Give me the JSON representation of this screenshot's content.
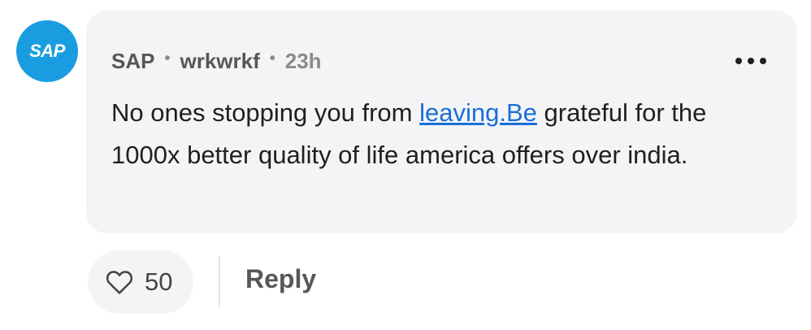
{
  "avatar": {
    "text": "SAP",
    "color": "#1a9de0"
  },
  "comment": {
    "company": "SAP",
    "username": "wrkwrkf",
    "separator": "•",
    "time": "23h",
    "more_icon": "more-horizontal-icon",
    "text_before_link": "No ones stopping you from ",
    "link_text": "leaving.Be",
    "text_after_link": " grateful for the 1000x better quality of life america offers over india.",
    "link_color": "#1a6fd6",
    "bubble_color": "#f4f4f7"
  },
  "actions": {
    "like_icon": "heart-outline-icon",
    "like_count": "50",
    "reply_label": "Reply"
  }
}
